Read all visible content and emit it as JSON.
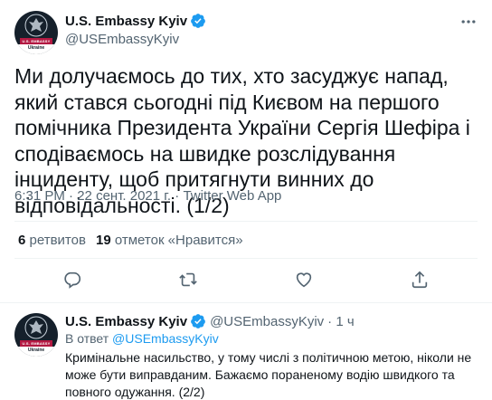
{
  "tweet": {
    "author": {
      "display_name": "U.S. Embassy Kyiv",
      "handle": "@USEmbassyKyiv",
      "avatar_text": "U.S. EMBASSY",
      "avatar_country": "Ukraine"
    },
    "text": "Ми долучаємось до тих, хто засуджує напад, який стався сьогодні під Києвом на першого помічника Президента України Сергія Шефіра і сподіваємось на швидке розслідування інциденту, щоб притягнути винних до відповідальності. (1/2)",
    "time": "6:31 PM",
    "separator": " · ",
    "date": "22 сент. 2021 г.",
    "source": "Twitter Web App",
    "retweets_count": "6",
    "retweets_label": "ретвитов",
    "likes_count": "19",
    "likes_label": "отметок «Нравится»"
  },
  "reply": {
    "author": {
      "display_name": "U.S. Embassy Kyiv",
      "handle": "@USEmbassyKyiv",
      "avatar_text": "U.S. EMBASSY",
      "avatar_country": "Ukraine"
    },
    "time_ago": "· 1 ч",
    "in_reply_prefix": "В ответ",
    "in_reply_mention": "@USEmbassyKyiv",
    "text": "Кримінальне насильство, у тому числі з політичною метою, ніколи не може бути виправданим. Бажаємо пораненому водію швидкого та повного одужання. (2/2)"
  },
  "colors": {
    "text_primary": "#0f1419",
    "text_secondary": "#536471",
    "accent": "#1d9bf0",
    "divider": "#eff3f4"
  },
  "icons": [
    "verified-badge-icon",
    "more-options-icon",
    "reply-icon",
    "retweet-icon",
    "like-icon",
    "share-icon",
    "embassy-seal-icon"
  ]
}
